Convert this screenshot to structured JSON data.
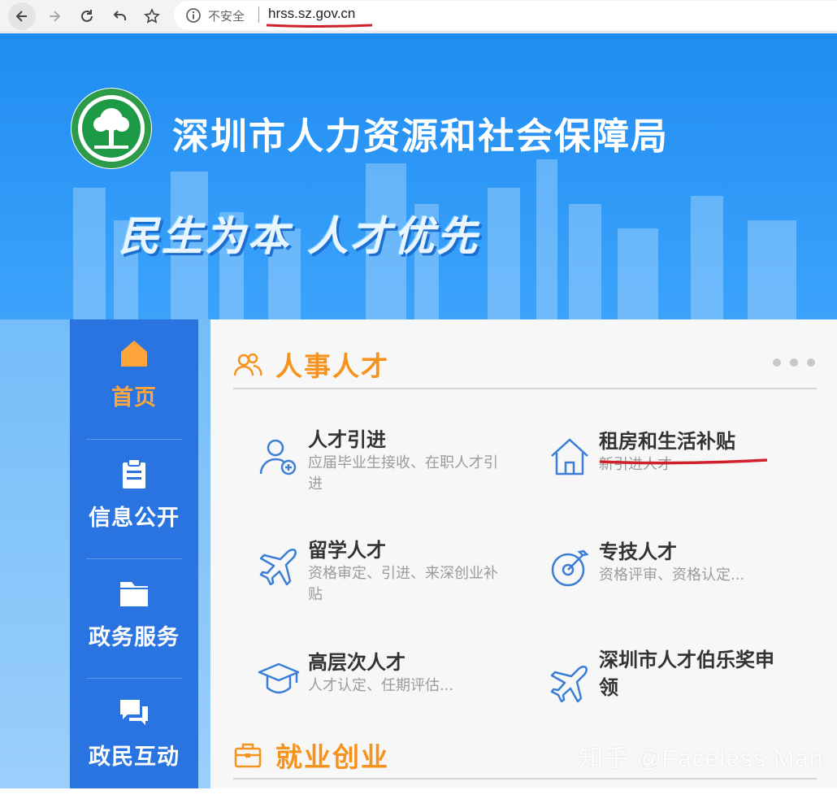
{
  "browser": {
    "security_label": "不安全",
    "url": "hrss.sz.gov.cn"
  },
  "header": {
    "org_name": "深圳市人力资源和社会保障局",
    "slogan": "民生为本 人才优先"
  },
  "side_nav": {
    "items": [
      {
        "label": "首页",
        "icon": "home-icon",
        "active": true
      },
      {
        "label": "信息公开",
        "icon": "clipboard-icon",
        "active": false
      },
      {
        "label": "政务服务",
        "icon": "folder-icon",
        "active": false
      },
      {
        "label": "政民互动",
        "icon": "chat-icon",
        "active": false
      }
    ]
  },
  "sections": [
    {
      "title": "人事人才",
      "icon": "people-icon",
      "items": [
        {
          "title": "人才引进",
          "desc": "应届毕业生接收、在职人才引进",
          "icon": "add-user-icon"
        },
        {
          "title": "租房和生活补贴",
          "desc": "新引进人才",
          "icon": "house-icon"
        },
        {
          "title": "留学人才",
          "desc": "资格审定、引进、来深创业补贴",
          "icon": "airplane-icon"
        },
        {
          "title": "专技人才",
          "desc": "资格评审、资格认定...",
          "icon": "target-icon"
        },
        {
          "title": "高层次人才",
          "desc": "人才认定、任期评估...",
          "icon": "graduation-cap-icon"
        },
        {
          "title": "深圳市人才伯乐奖申领",
          "desc": "",
          "icon": "airplane-icon"
        }
      ]
    },
    {
      "title": "就业创业",
      "icon": "briefcase-icon",
      "items": []
    }
  ],
  "watermark": "知乎 @Faceless Man",
  "colors": {
    "accent_orange": "#f5931d",
    "nav_blue": "#2a74e1",
    "item_icon_blue": "#3a7ed6",
    "annotation_red": "#d0202a"
  }
}
